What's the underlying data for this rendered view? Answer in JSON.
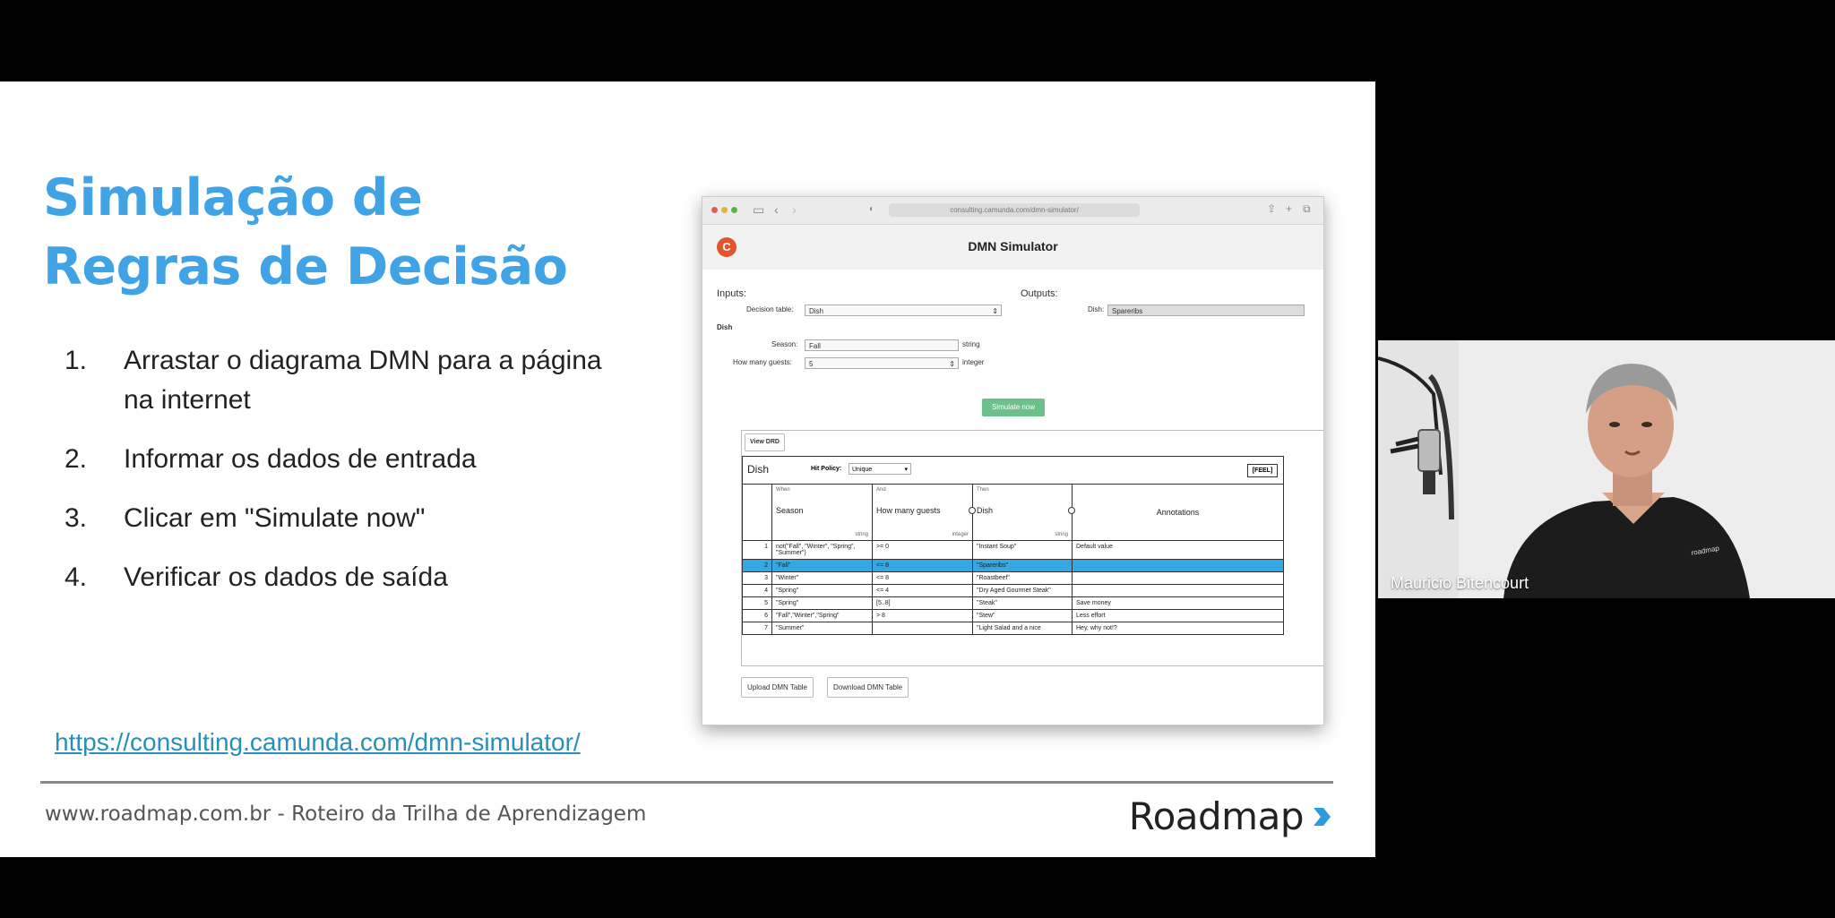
{
  "slide": {
    "title_line1": "Simulação de",
    "title_line2": "Regras de Decisão",
    "steps": [
      {
        "num": "1.",
        "text": "Arrastar o diagrama DMN para a página na internet"
      },
      {
        "num": "2.",
        "text": "Informar os dados de entrada"
      },
      {
        "num": "3.",
        "text": "Clicar em \"Simulate now\""
      },
      {
        "num": "4.",
        "text": "Verificar os dados de saída"
      }
    ],
    "link": "https://consulting.camunda.com/dmn-simulator/",
    "footer": "www.roadmap.com.br - Roteiro da Trilha de Aprendizagem",
    "brand": "Roadmap",
    "colors": {
      "title": "#3fa3e6",
      "brand_chevron": "#2e9be0",
      "link": "#2a8fb8"
    }
  },
  "browser": {
    "url": "consulting.camunda.com/dmn-simulator/",
    "app_title": "DMN Simulator",
    "logo_letter": "C",
    "inputs_label": "Inputs:",
    "outputs_label": "Outputs:",
    "decision_table_label": "Decision table:",
    "decision_table_value": "Dish",
    "output_dish_label": "Dish:",
    "output_dish_value": "Spareribs",
    "section_label": "Dish",
    "season_label": "Season:",
    "season_value": "Fall",
    "season_type": "string",
    "guests_label": "How many guests:",
    "guests_value": "5",
    "guests_type": "integer",
    "simulate_button": "Simulate now",
    "view_drd": "View DRD",
    "upload_button": "Upload DMN Table",
    "download_button": "Download DMN Table"
  },
  "dmn_table": {
    "name": "Dish",
    "hit_policy_label": "Hit Policy:",
    "hit_policy_value": "Unique",
    "feel_label": "[FEEL]",
    "columns": [
      {
        "small": "When",
        "name": "Season",
        "type": "string"
      },
      {
        "small": "And",
        "name": "How many guests",
        "type": "integer"
      },
      {
        "small": "Then",
        "name": "Dish",
        "type": "string"
      },
      {
        "small": "",
        "name": "Annotations",
        "type": ""
      }
    ],
    "rows": [
      {
        "n": "1",
        "season": "not(\"Fall\", \"Winter\", \"Spring\", \"Summer\")",
        "guests": ">= 0",
        "dish": "\"Instant Soup\"",
        "note": "Default value",
        "selected": false
      },
      {
        "n": "2",
        "season": "\"Fall\"",
        "guests": "<= 8",
        "dish": "\"Spareribs\"",
        "note": "",
        "selected": true
      },
      {
        "n": "3",
        "season": "\"Winter\"",
        "guests": "<= 8",
        "dish": "\"Roastbeef\"",
        "note": "",
        "selected": false
      },
      {
        "n": "4",
        "season": "\"Spring\"",
        "guests": "<= 4",
        "dish": "\"Dry Aged Gourmet Steak\"",
        "note": "",
        "selected": false
      },
      {
        "n": "5",
        "season": "\"Spring\"",
        "guests": "[5..8]",
        "dish": "\"Steak\"",
        "note": "Save money",
        "selected": false
      },
      {
        "n": "6",
        "season": "\"Fall\",\"Winter\",\"Spring\"",
        "guests": "> 8",
        "dish": "\"Stew\"",
        "note": "Less effort",
        "selected": false
      },
      {
        "n": "7",
        "season": "\"Summer\"",
        "guests": "",
        "dish": "\"Light Salad and a nice",
        "note": "Hey, why not!?",
        "selected": false
      }
    ]
  },
  "webcam": {
    "participant_name": "Mauricio Bitencourt"
  }
}
